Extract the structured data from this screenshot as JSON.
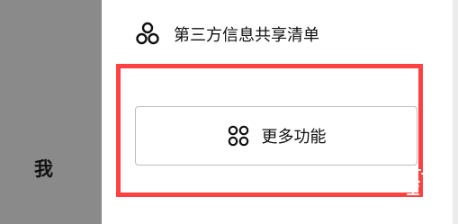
{
  "sidebar": {
    "label": "我"
  },
  "menu": {
    "item_label": "第三方信息共享清单",
    "item_icon": "share-nodes-icon"
  },
  "more_functions": {
    "label": "更多功能",
    "icon": "apps-grid-icon"
  },
  "colors": {
    "highlight": "#ff4141",
    "left_panel": "#8a8a8a",
    "button_border": "#bdbdbd"
  }
}
